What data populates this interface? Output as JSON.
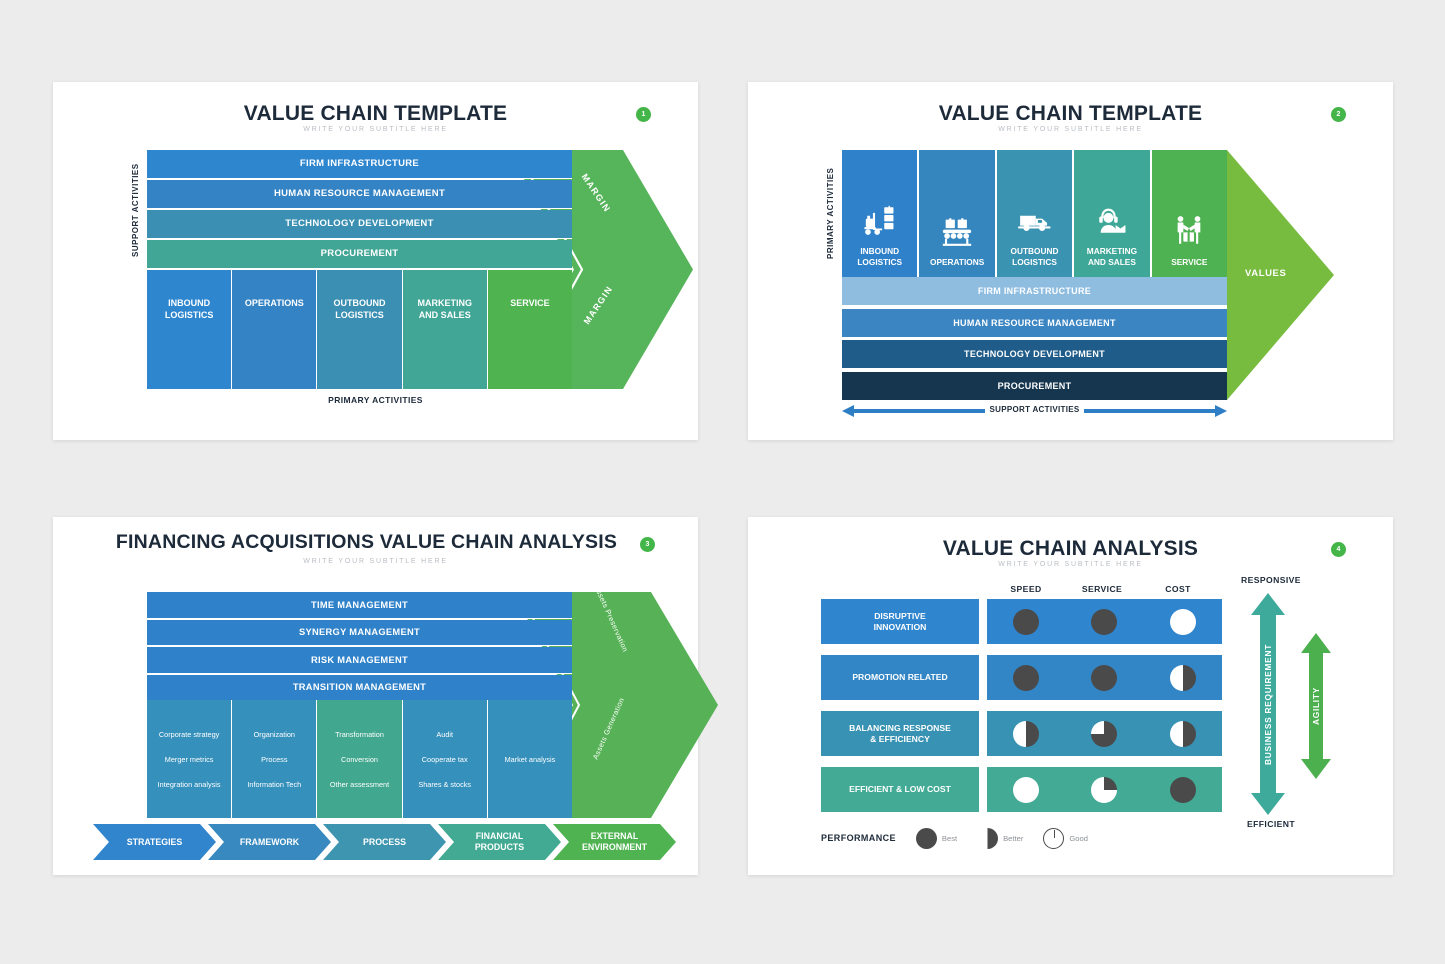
{
  "colors": {
    "blue1": "#2e86cf",
    "blue2": "#3a85c2",
    "blue3": "#3d8fb4",
    "teal1": "#3ea79e",
    "green1": "#4fb350",
    "green_arrow": "#56b45a",
    "green_arrow2": "#77bc3f",
    "navy": "#1b4161",
    "dark_slate": "#464646",
    "badge_green": "#44b649",
    "s2_light_blue": "#8fbde0",
    "s2_blue": "#3a85c2",
    "s2_dark_blue": "#1f5c89",
    "s2_navy": "#16354f",
    "s3_blue": "#2f82c9",
    "s3_arrow_green": "#57b257",
    "teal_arrow": "#3eaa9c"
  },
  "slide1": {
    "title": "VALUE CHAIN TEMPLATE",
    "subtitle": "WRITE YOUR SUBTITLE HERE",
    "badge": "1",
    "vertical_axis_label": "SUPPORT ACTIVITIES",
    "horizontal_axis_label": "PRIMARY ACTIVITIES",
    "support_rows": [
      {
        "label": "FIRM INFRASTRUCTURE",
        "color": "#2e86cf"
      },
      {
        "label": "HUMAN RESOURCE MANAGEMENT",
        "color": "#3483c4"
      },
      {
        "label": "TECHNOLOGY DEVELOPMENT",
        "color": "#3a8fb2"
      },
      {
        "label": "PROCUREMENT",
        "color": "#41a696"
      }
    ],
    "primary_cells": [
      {
        "label": "INBOUND LOGISTICS",
        "color": "#2e86cf"
      },
      {
        "label": "OPERATIONS",
        "color": "#3483c4"
      },
      {
        "label": "OUTBOUND LOGISTICS",
        "color": "#3a8fb2"
      },
      {
        "label": "MARKETING AND SALES",
        "color": "#41a696"
      },
      {
        "label": "SERVICE",
        "color": "#4fb350"
      }
    ],
    "margin_top_label": "MARGIN",
    "margin_bottom_label": "MARGIN",
    "arrow_color": "#56b45a"
  },
  "slide2": {
    "title": "VALUE CHAIN TEMPLATE",
    "subtitle": "WRITE YOUR SUBTITLE HERE",
    "badge": "2",
    "vertical_axis_label": "PRIMARY ACTIVITIES",
    "support_axis_label": "SUPPORT ACTIVITIES",
    "values_label": "VALUES",
    "arrow_color": "#77bc3f",
    "primary_cells": [
      {
        "label": "INBOUND LOGISTICS",
        "color": "#2f82c9",
        "icon": "forklift-icon"
      },
      {
        "label": "OPERATIONS",
        "color": "#3586bf",
        "icon": "conveyor-belt-icon"
      },
      {
        "label": "OUTBOUND LOGISTICS",
        "color": "#3a93b1",
        "icon": "delivery-truck-icon"
      },
      {
        "label": "MARKETING AND SALES",
        "color": "#3fa798",
        "icon": "headset-support-icon"
      },
      {
        "label": "SERVICE",
        "color": "#4fb252",
        "icon": "handshake-delivery-icon"
      }
    ],
    "support_rows": [
      {
        "label": "FIRM INFRASTRUCTURE",
        "color": "#8fbde0"
      },
      {
        "label": "HUMAN RESOURCE MANAGEMENT",
        "color": "#3a85c2"
      },
      {
        "label": "TECHNOLOGY DEVELOPMENT",
        "color": "#1f5c89"
      },
      {
        "label": "PROCUREMENT",
        "color": "#16354f"
      }
    ]
  },
  "slide3": {
    "title": "FINANCING ACQUISITIONS VALUE CHAIN ANALYSIS",
    "subtitle": "WRITE YOUR SUBTITLE HERE",
    "badge": "3",
    "support_rows": [
      {
        "label": "TIME MANAGEMENT",
        "color": "#2f82c9"
      },
      {
        "label": "SYNERGY MANAGEMENT",
        "color": "#2f82c9"
      },
      {
        "label": "RISK MANAGEMENT",
        "color": "#2f82c9"
      },
      {
        "label": "TRANSITION MANAGEMENT",
        "color": "#2f82c9"
      }
    ],
    "primary_columns": [
      {
        "color": "#3590bb",
        "items": [
          "Corporate strategy",
          "Merger metrics",
          "Integration analysis"
        ]
      },
      {
        "color": "#3590bb",
        "items": [
          "Organization",
          "Process",
          "Information Tech"
        ]
      },
      {
        "color": "#41a78e",
        "items": [
          "Transformation",
          "Conversion",
          "Other assessment"
        ]
      },
      {
        "color": "#3590bb",
        "items": [
          "Audit",
          "Cooperate tax",
          "Shares & stocks"
        ]
      },
      {
        "color": "#3590bb",
        "items": [
          "Market analysis"
        ]
      }
    ],
    "arrow_color": "#57b257",
    "arrow_top_label": "Assets Preservation",
    "arrow_bottom_label": "Assets Generation",
    "chevrons": [
      {
        "label": "STRATEGIES",
        "color": "#3185cd"
      },
      {
        "label": "FRAMEWORK",
        "color": "#3789c0"
      },
      {
        "label": "PROCESS",
        "color": "#3d95b0"
      },
      {
        "label": "FINANCIAL PRODUCTS",
        "color": "#42aa93"
      },
      {
        "label": "EXTERNAL ENVIRONMENT",
        "color": "#4fb352"
      }
    ]
  },
  "slide4": {
    "title": "VALUE CHAIN ANALYSIS",
    "subtitle": "WRITE YOUR SUBTITLE HERE",
    "badge": "4",
    "columns": [
      "SPEED",
      "SERVICE",
      "COST"
    ],
    "rows": [
      {
        "label": "DISRUPTIVE INNOVATION",
        "color": "#2f86cf",
        "values": [
          "full",
          "full",
          "empty"
        ]
      },
      {
        "label": "PROMOTION RELATED",
        "color": "#3386c6",
        "values": [
          "full",
          "full",
          "half"
        ]
      },
      {
        "label": "BALANCING RESPONSE & EFFICIENCY",
        "color": "#3892b3",
        "values": [
          "half",
          "three-quarter",
          "half"
        ]
      },
      {
        "label": "EFFICIENT & LOW COST",
        "color": "#42aa95",
        "values": [
          "empty",
          "quarter",
          "full"
        ]
      }
    ],
    "axis_top_label": "RESPONSIVE",
    "axis_bottom_label": "EFFICIENT",
    "arrows": [
      {
        "label": "BUSINESS REQUIREMENT",
        "color": "#3eaa9c"
      },
      {
        "label": "AGILITY",
        "color": "#4cb04f"
      }
    ],
    "legend_title": "PERFORMANCE",
    "legend_items": [
      {
        "label": "Best",
        "state": "full"
      },
      {
        "label": "Better",
        "state": "half"
      },
      {
        "label": "Good",
        "state": "good"
      }
    ]
  }
}
